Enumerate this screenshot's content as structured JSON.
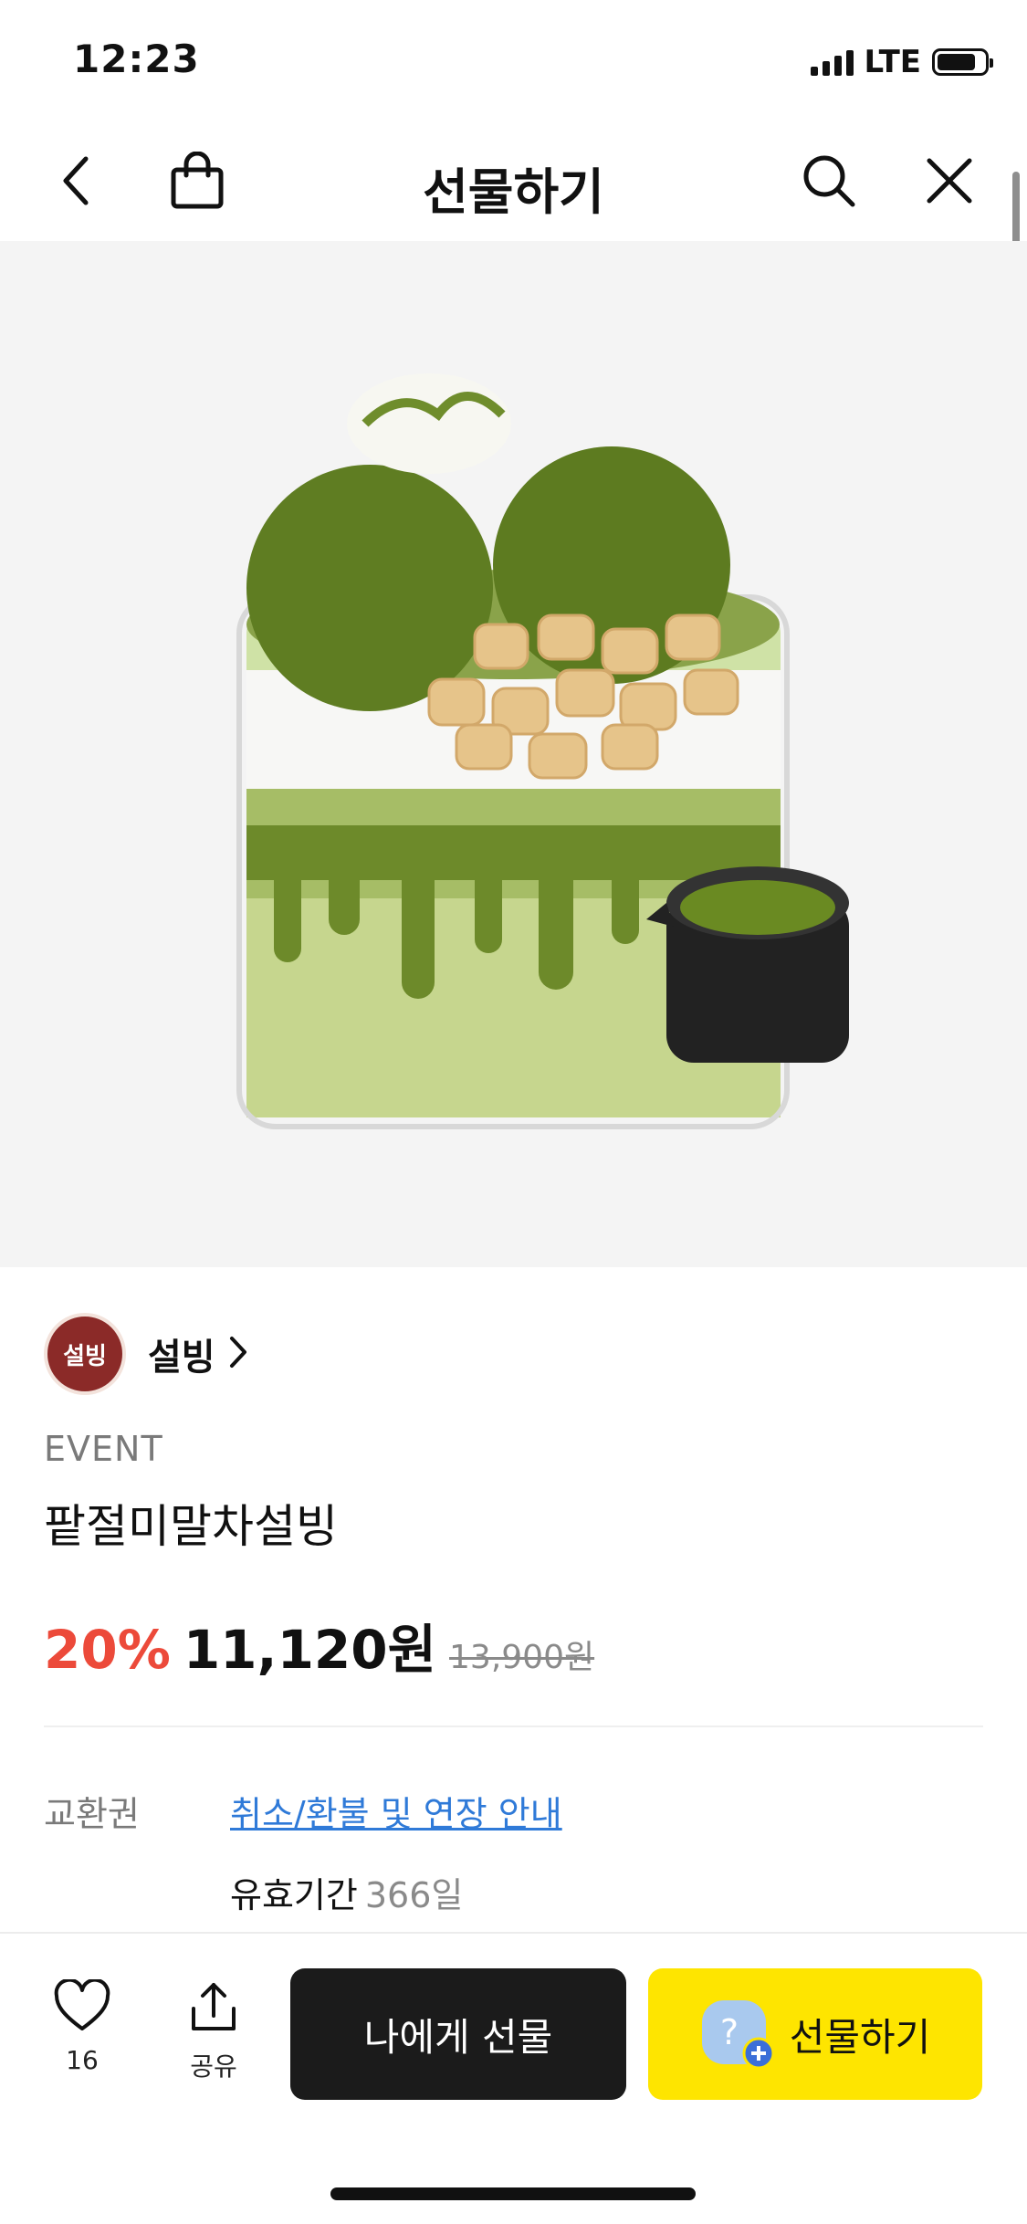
{
  "status_bar": {
    "time": "12:23",
    "network": "LTE"
  },
  "nav": {
    "title": "선물하기",
    "icons": [
      "back-icon",
      "shopping-bag-icon",
      "search-icon",
      "close-icon"
    ]
  },
  "product": {
    "brand": "설빙",
    "brand_logo_text": "설빙",
    "event_label": "EVENT",
    "name": "팥절미말차설빙",
    "discount": "20%",
    "price": "11,120원",
    "original_price": "13,900원"
  },
  "voucher": {
    "label": "교환권",
    "link_text": "취소/환불 및 연장 안내",
    "validity_label": "유효기간",
    "validity_value": "366일"
  },
  "bottom_bar": {
    "like_count": "16",
    "share_label": "공유",
    "self_gift_label": "나에게 선물",
    "gift_label": "선물하기"
  },
  "colors": {
    "discount": "#ec4a3a",
    "gift_button": "#fee500",
    "self_gift_button": "#1b1b1b",
    "link": "#2f7ad8"
  }
}
